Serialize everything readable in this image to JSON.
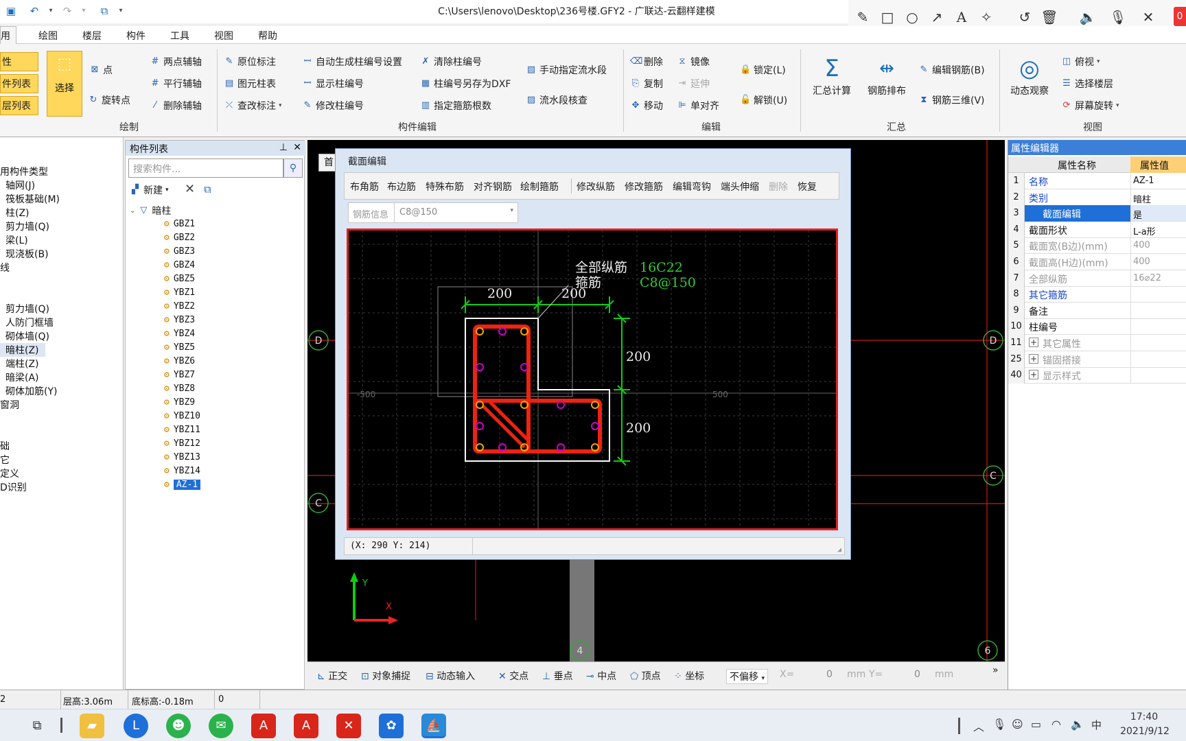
{
  "window": {
    "title": "C:\\Users\\lenovo\\Desktop\\236号楼.GFY2 - 广联达-云翻样建模"
  },
  "annotate_tools": [
    "pencil-icon",
    "square-icon",
    "circle-icon",
    "arrow-icon",
    "text-icon",
    "highlighter-icon",
    "undo-icon",
    "trash-icon",
    "speaker-icon",
    "mic-icon",
    "close-icon"
  ],
  "annotate_badge": "0",
  "menu": [
    "用",
    "绘图",
    "楼层",
    "构件",
    "工具",
    "视图",
    "帮助"
  ],
  "ribbon": {
    "left_buttons": [
      "性",
      "件列表",
      "层列表"
    ],
    "select": "选择",
    "point": "点",
    "rotate_point": "旋转点",
    "aux": [
      "两点辅轴",
      "平行辅轴",
      "删除辅轴"
    ],
    "draw_group": "绘制",
    "labels": [
      "原位标注",
      "图元柱表",
      "查改标注"
    ],
    "col_edit": [
      "自动生成柱编号设置",
      "显示柱编号",
      "修改柱编号"
    ],
    "col_edit2": [
      "清除柱编号",
      "柱编号另存为DXF",
      "指定箍筋根数"
    ],
    "flow": [
      "手动指定流水段",
      "流水段核查"
    ],
    "comp_edit_group": "构件编辑",
    "edit1": [
      "删除",
      "复制",
      "移动"
    ],
    "edit2": [
      "镜像",
      "延伸",
      "单对齐"
    ],
    "lock": [
      "锁定(L)",
      "解锁(U)"
    ],
    "edit_group": "编辑",
    "sum": "汇总计算",
    "rebar_arr": "钢筋排布",
    "edit_rebar": "编辑钢筋(B)",
    "rebar3d": "钢筋三维(V)",
    "sum_group": "汇总",
    "dyn": "动态观察",
    "view_items": [
      "俯视",
      "选择楼层",
      "屏幕旋转"
    ],
    "view_group": "视图"
  },
  "left_tree": [
    "用构件类型",
    "轴网(J)",
    "筏板基础(M)",
    "柱(Z)",
    "剪力墙(Q)",
    "梁(L)",
    "现浇板(B)",
    "线",
    "剪力墙(Q)",
    "人防门框墙",
    "砌体墙(Q)",
    "暗柱(Z)",
    "端柱(Z)",
    "暗梁(A)",
    "砌体加筋(Y)",
    "窗洞",
    "础",
    "它",
    "定义",
    "D识别"
  ],
  "complist": {
    "header": "构件列表",
    "search_placeholder": "搜索构件...",
    "new": "新建",
    "group": "暗柱",
    "items": [
      "GBZ1",
      "GBZ2",
      "GBZ3",
      "GBZ4",
      "GBZ5",
      "YBZ1",
      "YBZ2",
      "YBZ3",
      "YBZ4",
      "YBZ5",
      "YBZ6",
      "YBZ7",
      "YBZ8",
      "YBZ9",
      "YBZ10",
      "YBZ11",
      "YBZ12",
      "YBZ13",
      "YBZ14",
      "AZ-1"
    ]
  },
  "canvas_tab": "首",
  "axis_labels": {
    "d_left": "D",
    "d_right": "D",
    "c_left": "C",
    "c_right": "C",
    "a4": "4",
    "a6": "6",
    "y": "Y",
    "x": "X"
  },
  "dialog": {
    "title": "截面编辑",
    "tools": [
      "布角筋",
      "布边筋",
      "特殊布筋",
      "对齐钢筋",
      "绘制箍筋",
      "修改纵筋",
      "修改箍筋",
      "编辑弯钩",
      "端头伸缩",
      "删除",
      "恢复"
    ],
    "rebar_info_label": "钢筋信息",
    "rebar_info_value": "C8@150",
    "status": "(X: 290 Y: 214)",
    "drawing": {
      "label_all": "全部纵筋",
      "label_stirrup": "箍筋",
      "val_all": "16C22",
      "val_stirrup": "C8@150",
      "dim_a": "200",
      "dim_b": "200",
      "dim_c": "200",
      "dim_d": "200",
      "grid_l": "-500",
      "grid_r": "500"
    }
  },
  "canvas_bar": [
    "正交",
    "对象捕捉",
    "动态输入",
    "交点",
    "垂点",
    "中点",
    "顶点",
    "坐标",
    "不偏移",
    "X=",
    "0",
    "mm",
    "Y=",
    "0",
    "mm"
  ],
  "props": {
    "header": "属性编辑器",
    "col_name": "属性名称",
    "col_val": "属性值",
    "rows": [
      {
        "n": "1",
        "name": "名称",
        "val": "AZ-1",
        "style": "blue"
      },
      {
        "n": "2",
        "name": "类别",
        "val": "暗柱",
        "style": "blue"
      },
      {
        "n": "3",
        "name": "截面编辑",
        "val": "是",
        "style": "sel"
      },
      {
        "n": "4",
        "name": "截面形状",
        "val": "L-a形",
        "style": ""
      },
      {
        "n": "5",
        "name": "截面宽(B边)(mm)",
        "val": "400",
        "style": "gray"
      },
      {
        "n": "6",
        "name": "截面高(H边)(mm)",
        "val": "400",
        "style": "gray"
      },
      {
        "n": "7",
        "name": "全部纵筋",
        "val": "16⌀22",
        "style": "gray"
      },
      {
        "n": "8",
        "name": "其它箍筋",
        "val": "",
        "style": "blue"
      },
      {
        "n": "9",
        "name": "备注",
        "val": "",
        "style": ""
      },
      {
        "n": "10",
        "name": "柱编号",
        "val": "",
        "style": ""
      },
      {
        "n": "11",
        "name": "其它属性",
        "val": "",
        "style": "plus"
      },
      {
        "n": "25",
        "name": "锚固搭接",
        "val": "",
        "style": "plus"
      },
      {
        "n": "40",
        "name": "显示样式",
        "val": "",
        "style": "plus"
      }
    ]
  },
  "statusbar": {
    "c": "2",
    "floor_h": "层高:3.06m",
    "base_h": "底标高:-0.18m",
    "zero": "0"
  },
  "taskbar": {
    "time": "17:40",
    "date": "2021/9/12",
    "ime": "中"
  }
}
